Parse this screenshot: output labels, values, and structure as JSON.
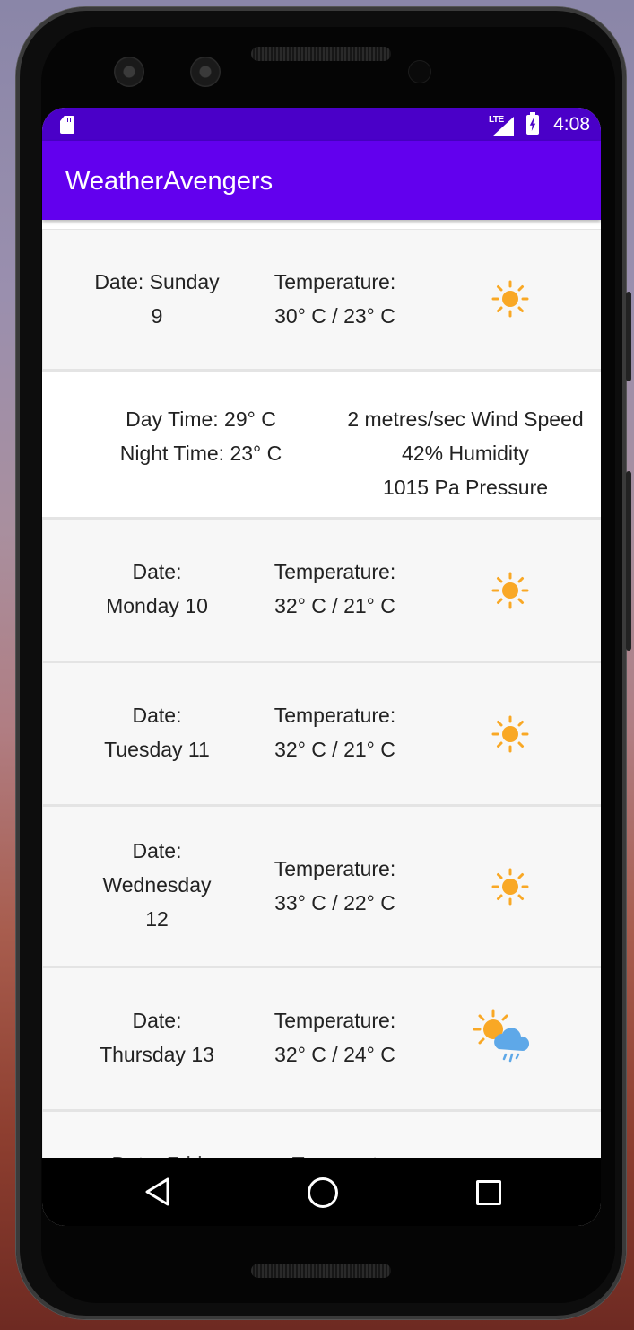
{
  "status_bar": {
    "network": "LTE",
    "time": "4:08"
  },
  "app_bar": {
    "title": "WeatherAvengers"
  },
  "forecast": [
    {
      "date_line1": "Date: Sunday",
      "date_line2": "9",
      "temp_label": "Temperature:",
      "temp_range": "30° C / 23° C",
      "icon": "sun-icon"
    },
    {
      "date_line1": "Date:",
      "date_line2": "Monday 10",
      "temp_label": "Temperature:",
      "temp_range": "32° C / 21° C",
      "icon": "sun-icon"
    },
    {
      "date_line1": "Date:",
      "date_line2": "Tuesday 11",
      "temp_label": "Temperature:",
      "temp_range": "32° C / 21° C",
      "icon": "sun-icon"
    },
    {
      "date_line1": "Date:",
      "date_line2": "Wednesday",
      "date_line3": "12",
      "temp_label": "Temperature:",
      "temp_range": "33° C / 22° C",
      "icon": "sun-icon"
    },
    {
      "date_line1": "Date:",
      "date_line2": "Thursday 13",
      "temp_label": "Temperature:",
      "temp_range": "32° C / 24° C",
      "icon": "sun-rain-cloud-icon"
    },
    {
      "date_line1": "Date: Frid",
      "temp_label": "Temperat"
    }
  ],
  "details": {
    "day_time": "Day Time: 29° C",
    "night_time": "Night Time: 23° C",
    "wind": "2 metres/sec Wind Speed",
    "humidity": "42% Humidity",
    "pressure": "1015 Pa Pressure"
  },
  "colors": {
    "status_bar": "#4a00c8",
    "app_bar": "#6200ee",
    "sun": "#f9a825",
    "cloud": "#5ea8e8"
  }
}
